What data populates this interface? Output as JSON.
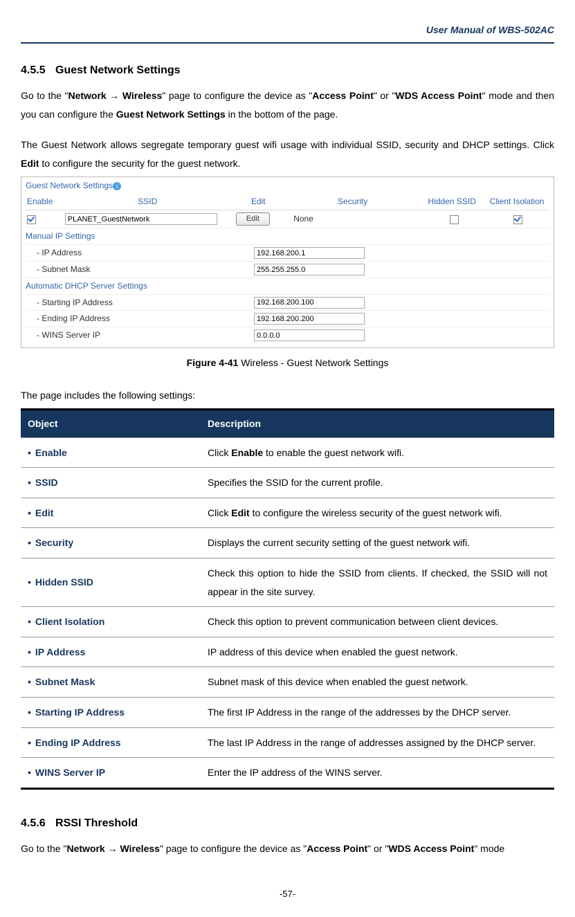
{
  "header": {
    "title": "User  Manual  of  WBS-502AC"
  },
  "section1": {
    "num": "4.5.5",
    "title": "Guest Network Settings",
    "p1_a": "Go to the \"",
    "p1_b": "Network",
    "p1_c": " → ",
    "p1_d": "Wireless",
    "p1_e": "\" page to configure the device as \"",
    "p1_f": "Access Point",
    "p1_g": "\" or \"",
    "p1_h": "WDS Access Point",
    "p1_i": "\" mode and then you can configure the ",
    "p1_j": "Guest Network Settings",
    "p1_k": " in the bottom of the page.",
    "p2_a": "The  Guest  Network  allows  segregate  temporary  guest  wifi  usage  with  individual  SSID,  security  and  DHCP settings. Click ",
    "p2_b": "Edit",
    "p2_c": " to configure the security for the guest network."
  },
  "figure": {
    "title": "Guest Network Settings",
    "headers": {
      "enable": "Enable",
      "ssid": "SSID",
      "edit": "Edit",
      "security": "Security",
      "hidden": "Hidden SSID",
      "ci": "Client Isolation"
    },
    "row": {
      "ssid_value": "PLANET_GuestNetwork",
      "edit_btn": "Edit",
      "security_val": "None",
      "enable_checked": true,
      "hidden_checked": false,
      "ci_checked": true
    },
    "manual_head": "Manual IP Settings",
    "manual": {
      "ip_label": "- IP Address",
      "ip_val": "192.168.200.1",
      "mask_label": "- Subnet Mask",
      "mask_val": "255.255.255.0"
    },
    "dhcp_head": "Automatic DHCP Server Settings",
    "dhcp": {
      "start_label": "- Starting IP Address",
      "start_val": "192.168.200.100",
      "end_label": "- Ending IP Address",
      "end_val": "192.168.200.200",
      "wins_label": "- WINS Server IP",
      "wins_val": "0.0.0.0"
    },
    "caption_bold": "Figure 4-41",
    "caption_rest": " Wireless - Guest Network Settings"
  },
  "settings_intro": "The page includes the following settings:",
  "table": {
    "head_obj": "Object",
    "head_desc": "Description",
    "rows": [
      {
        "obj": "Enable",
        "desc_pre": "Click ",
        "desc_bold": "Enable",
        "desc_post": " to enable the guest network wifi."
      },
      {
        "obj": "SSID",
        "desc": "Specifies the SSID for the current profile."
      },
      {
        "obj": "Edit",
        "desc_pre": "Click ",
        "desc_bold": "Edit",
        "desc_post": " to configure the wireless security of the guest network wifi."
      },
      {
        "obj": "Security",
        "desc": "Displays the current security setting of the guest network wifi."
      },
      {
        "obj": "Hidden SSID",
        "desc": "Check this option to hide the SSID from clients. If checked, the SSID will not appear in the site survey."
      },
      {
        "obj": "Client Isolation",
        "desc": "Check this option to prevent communication between client devices."
      },
      {
        "obj": "IP Address",
        "desc": "IP address of this device when enabled the guest network."
      },
      {
        "obj": "Subnet Mask",
        "desc": "Subnet mask of this device when enabled the guest network."
      },
      {
        "obj": "Starting IP Address",
        "desc": "The first IP Address in the range of the addresses by the DHCP server."
      },
      {
        "obj": "Ending IP Address",
        "desc": "The  last  IP  Address  in  the  range  of  addresses  assigned  by  the  DHCP server."
      },
      {
        "obj": "WINS Server IP",
        "desc": "Enter the IP address of the WINS server."
      }
    ]
  },
  "section2": {
    "num": "4.5.6",
    "title": "RSSI Threshold",
    "p1_a": "Go to the \"",
    "p1_b": "Network",
    "p1_c": " → ",
    "p1_d": "Wireless",
    "p1_e": "\" page to configure the device as \"",
    "p1_f": "Access Point",
    "p1_g": "\" or \"",
    "p1_h": "WDS Access Point",
    "p1_i": "\" mode"
  },
  "footer": {
    "page": "-57-"
  }
}
